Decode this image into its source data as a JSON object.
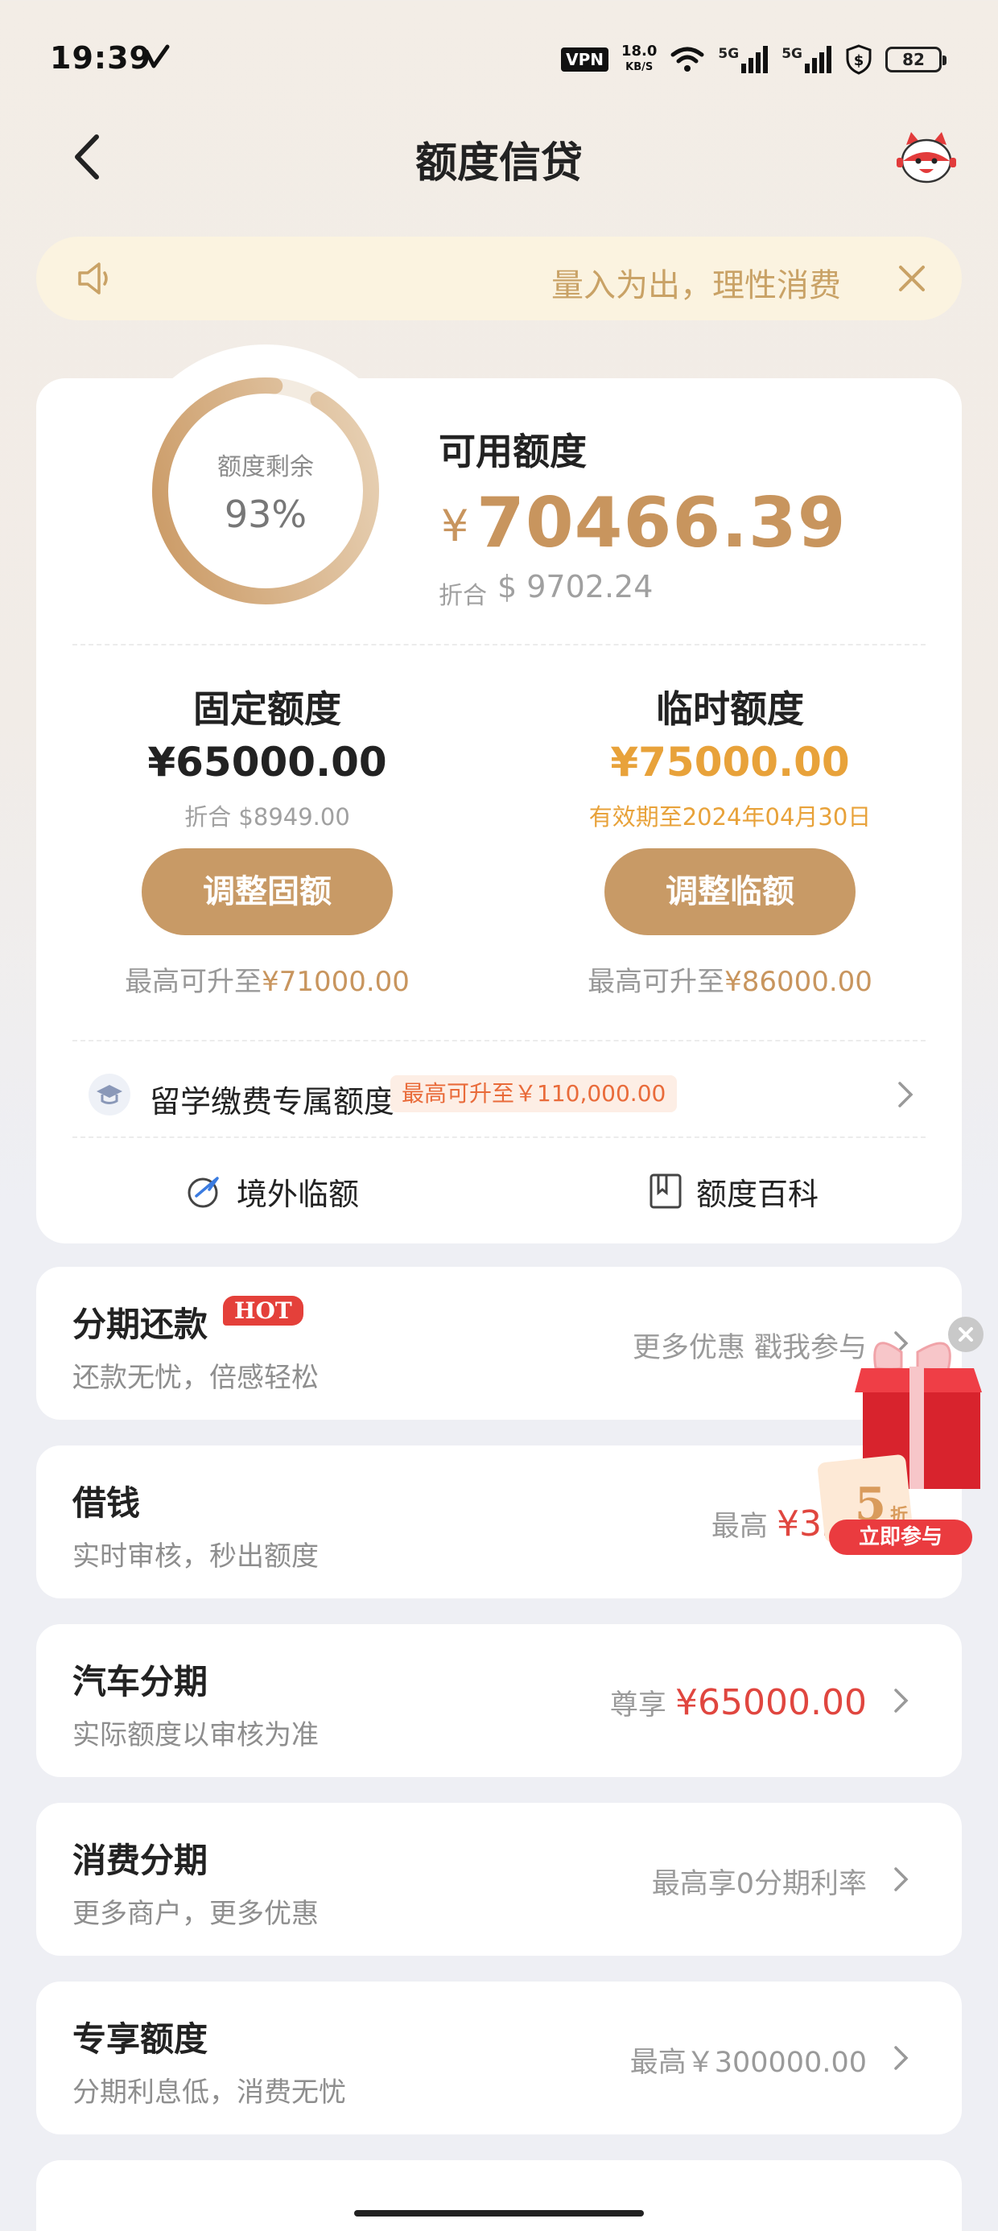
{
  "status_bar": {
    "time": "19:39",
    "vpn": "VPN",
    "speed_value": "18.0",
    "speed_unit": "KB/S",
    "signal1": "5G",
    "signal2": "5G",
    "battery": "82",
    "icons": [
      "checkmark-icon",
      "wifi-icon",
      "signal-icon",
      "signal-icon",
      "shield-dollar-icon",
      "battery-icon"
    ]
  },
  "header": {
    "title": "额度信贷",
    "icons": [
      "back-arrow-icon",
      "mascot-icon"
    ]
  },
  "notice": {
    "text": "量入为出，理性消费",
    "icons": [
      "speaker-icon",
      "close-icon"
    ]
  },
  "credit": {
    "ring_label": "额度剩余",
    "ring_percent": "93%",
    "ring_fraction": 0.93,
    "available_label": "可用额度",
    "available_currency": "¥",
    "available_amount": "70466.39",
    "converted_label": "折合",
    "converted_amount": "$ 9702.24"
  },
  "fixed": {
    "title": "固定额度",
    "amount": "¥65000.00",
    "converted": "折合 $8949.00",
    "button": "调整固额",
    "max_prefix": "最高可升至",
    "max_value": "¥71000.00"
  },
  "temporary": {
    "title": "临时额度",
    "amount": "¥75000.00",
    "validity": "有效期至2024年04月30日",
    "button": "调整临额",
    "max_prefix": "最高可升至",
    "max_value": "¥86000.00"
  },
  "study_abroad": {
    "label": "留学缴费专属额度",
    "badge": "最高可升至￥110,000.00",
    "icons": [
      "graduation-cap-icon",
      "chevron-right-icon"
    ]
  },
  "links": {
    "overseas": "境外临额",
    "encyclopedia": "额度百科",
    "icons": [
      "globe-plane-icon",
      "book-icon"
    ]
  },
  "services": [
    {
      "title": "分期还款",
      "badge": "HOT",
      "subtitle": "还款无忧，倍感轻松",
      "right_prefix": "更多优惠 戳我参与",
      "right_value": ""
    },
    {
      "title": "借钱",
      "badge": "",
      "subtitle": "实时审核，秒出额度",
      "right_prefix": "最高 ",
      "right_value": "¥325"
    },
    {
      "title": "汽车分期",
      "badge": "",
      "subtitle": "实际额度以审核为准",
      "right_prefix": "尊享 ",
      "right_value": "¥65000.00"
    },
    {
      "title": "消费分期",
      "badge": "",
      "subtitle": "更多商户，更多优惠",
      "right_prefix": "最高享0分期利率",
      "right_value": ""
    },
    {
      "title": "专享额度",
      "badge": "",
      "subtitle": "分期利息低，消费无忧",
      "right_prefix": "最高￥300000.00",
      "right_value": ""
    }
  ],
  "promo": {
    "discount": "5",
    "discount_unit": "折",
    "button": "立即参与",
    "icons": [
      "gift-box-icon",
      "close-icon"
    ]
  },
  "colors": {
    "gold": "#c8955e",
    "gold_button": "#c89a66",
    "temp_amount": "#e8a23a",
    "red": "#e0463f",
    "notice_bg": "#fbf3e0"
  }
}
